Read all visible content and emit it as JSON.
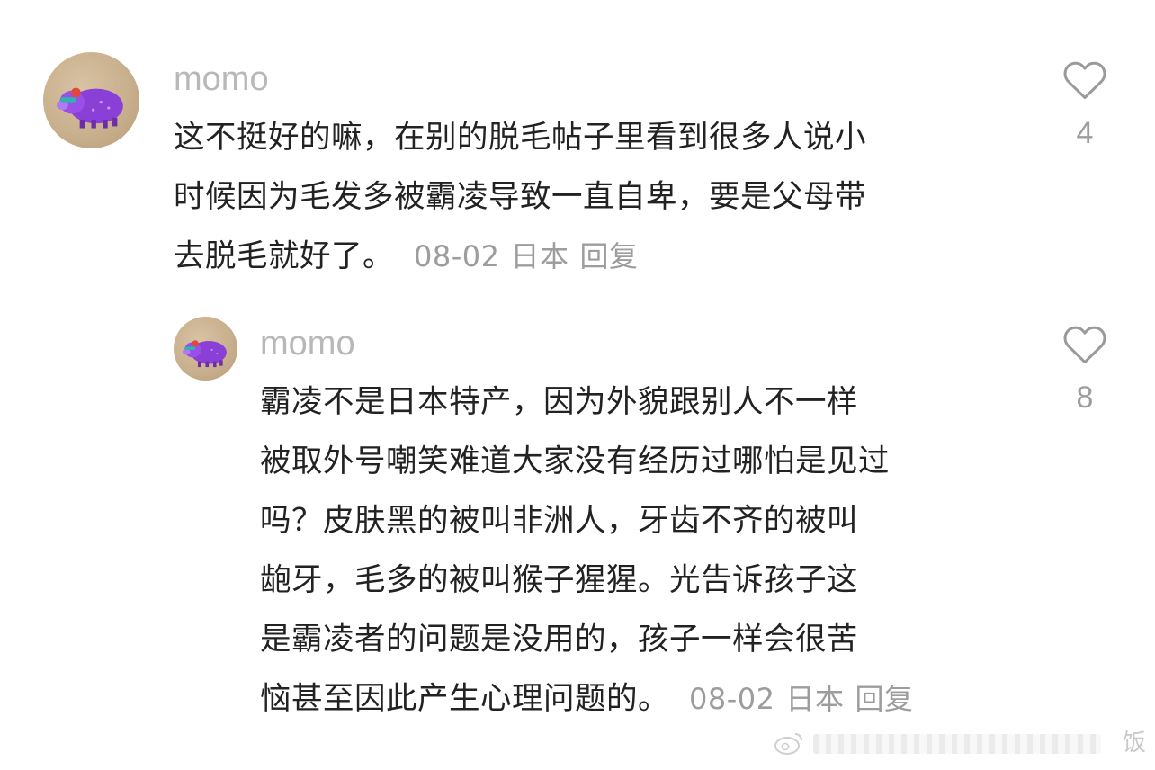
{
  "comments": [
    {
      "username": "momo",
      "lines": [
        "这不挺好的嘛，在别的脱毛帖子里看到很多人说小",
        "时候因为毛发多被霸凌导致一直自卑，要是父母带",
        "去脱毛就好了。"
      ],
      "date": "08-02",
      "location": "日本",
      "reply_label": "回复",
      "likes": "4",
      "avatar_icon": "purple-pig-avatar"
    },
    {
      "username": "momo",
      "lines": [
        "霸凌不是日本特产，因为外貌跟别人不一样",
        "被取外号嘲笑难道大家没有经历过哪怕是见过",
        "吗？皮肤黑的被叫非洲人，牙齿不齐的被叫",
        "龅牙，毛多的被叫猴子猩猩。光告诉孩子这",
        "是霸凌者的问题是没用的，孩子一样会很苦",
        "恼甚至因此产生心理问题的。"
      ],
      "date": "08-02",
      "location": "日本",
      "reply_label": "回复",
      "likes": "8",
      "avatar_icon": "purple-pig-avatar"
    }
  ],
  "watermark": {
    "icon": "weibo-logo-icon",
    "text": "饭"
  },
  "colors": {
    "username": "#b8b8b8",
    "body_text": "#222222",
    "meta": "#9d9d9d",
    "avatar_bg": "#c9b08e",
    "pig": "#8a3fd6"
  }
}
